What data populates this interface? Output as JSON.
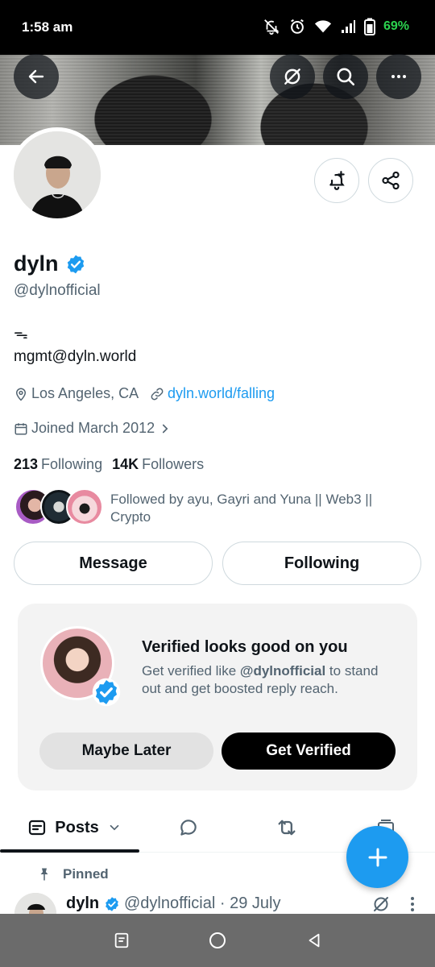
{
  "status_bar": {
    "time": "1:58 am",
    "battery": "69%"
  },
  "profile": {
    "name": "dyln",
    "handle": "@dylnofficial",
    "bio_symbol": "ᯓ",
    "bio_email": "mgmt@dyln.world",
    "location": "Los Angeles, CA",
    "website": "dyln.world/falling",
    "joined": "Joined March 2012",
    "following_count": "213",
    "following_label": "Following",
    "followers_count": "14K",
    "followers_label": "Followers",
    "followed_by": "Followed by ayu, Gayri and Yuna || Web3 || Crypto"
  },
  "actions": {
    "message": "Message",
    "following": "Following"
  },
  "verify_card": {
    "title": "Verified looks good on you",
    "sub_prefix": "Get verified like ",
    "sub_handle": "@dylnofficial",
    "sub_suffix": " to stand out and get boosted reply reach.",
    "maybe_later": "Maybe Later",
    "get_verified": "Get Verified"
  },
  "tabs": {
    "posts": "Posts"
  },
  "pinned_post": {
    "pinned_label": "Pinned",
    "name": "dyln",
    "handle_date": "@dylnofficial · 29 July"
  },
  "colors": {
    "accent": "#1d9bf0",
    "text": "#0f1419",
    "muted": "#536471",
    "battery": "#2bd24e"
  },
  "icons": [
    "back-arrow-icon",
    "grok-icon",
    "search-icon",
    "more-icon",
    "bell-plus-icon",
    "share-icon",
    "verified-badge-icon",
    "location-icon",
    "link-icon",
    "calendar-icon",
    "chevron-right-icon",
    "posts-icon",
    "chevron-down-icon",
    "reply-icon",
    "repost-icon",
    "media-icon",
    "pin-icon",
    "plus-icon"
  ]
}
